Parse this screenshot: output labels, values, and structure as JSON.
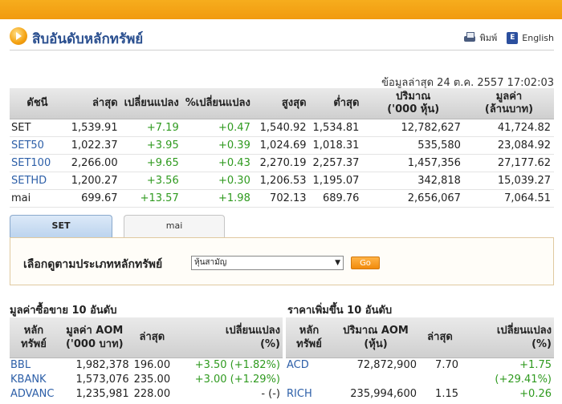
{
  "header": {
    "title": "สิบอันดับหลักทรัพย์",
    "print_label": "พิมพ์",
    "lang_label": "English",
    "lang_icon_text": "E"
  },
  "update_time": "ข้อมูลล่าสุด 24 ต.ค. 2557 17:02:03",
  "index_table": {
    "headers": [
      "ดัชนี",
      "ล่าสุด",
      "เปลี่ยนแปลง",
      "%เปลี่ยนแปลง",
      "สูงสุด",
      "ต่ำสุด",
      "ปริมาณ\n('000 หุ้น)",
      "มูลค่า\n(ล้านบาท)"
    ],
    "rows": [
      {
        "name": "SET",
        "last": "1,539.91",
        "change": "+7.19",
        "pct": "+0.47",
        "high": "1,540.92",
        "low": "1,534.81",
        "volume": "12,782,627",
        "value": "41,724.82"
      },
      {
        "name": "SET50",
        "last": "1,022.37",
        "change": "+3.95",
        "pct": "+0.39",
        "high": "1,024.69",
        "low": "1,018.31",
        "volume": "535,580",
        "value": "23,084.92"
      },
      {
        "name": "SET100",
        "last": "2,266.00",
        "change": "+9.65",
        "pct": "+0.43",
        "high": "2,270.19",
        "low": "2,257.37",
        "volume": "1,457,356",
        "value": "27,177.62"
      },
      {
        "name": "SETHD",
        "last": "1,200.27",
        "change": "+3.56",
        "pct": "+0.30",
        "high": "1,206.53",
        "low": "1,195.07",
        "volume": "342,818",
        "value": "15,039.27"
      },
      {
        "name": "mai",
        "last": "699.67",
        "change": "+13.57",
        "pct": "+1.98",
        "high": "702.13",
        "low": "689.76",
        "volume": "2,656,067",
        "value": "7,064.51"
      }
    ]
  },
  "tabs": {
    "set": "SET",
    "mai": "mai"
  },
  "filter": {
    "label": "เลือกดูตามประเภทหลักทรัพย์",
    "selected": "หุ้นสามัญ",
    "go_label": "Go"
  },
  "left_section": {
    "title": "มูลค่าซื้อขาย 10 อันดับ",
    "headers": [
      "หลัก\nทรัพย์",
      "มูลค่า AOM\n('000 บาท)",
      "ล่าสุด",
      "เปลี่ยนแปลง\n(%)"
    ],
    "rows": [
      {
        "name": "BBL",
        "value": "1,982,378",
        "last": "196.00",
        "change": "+3.50 (+1.82%)"
      },
      {
        "name": "KBANK",
        "value": "1,573,076",
        "last": "235.00",
        "change": "+3.00 (+1.29%)"
      },
      {
        "name": "ADVANC",
        "value": "1,235,981",
        "last": "228.00",
        "change": "- (-)"
      }
    ]
  },
  "right_section": {
    "title": "ราคาเพิ่มขึ้น 10 อันดับ",
    "headers": [
      "หลัก\nทรัพย์",
      "ปริมาณ AOM\n(หุ้น)",
      "ล่าสุด",
      "เปลี่ยนแปลง\n(%)"
    ],
    "rows": [
      {
        "name": "ACD",
        "volume": "72,872,900",
        "last": "7.70",
        "change": "+1.75",
        "pct": "(+29.41%)"
      },
      {
        "name": "RICH",
        "volume": "235,994,600",
        "last": "1.15",
        "change": "+0.26",
        "pct": ""
      }
    ]
  },
  "colors": {
    "accent_orange": "#f19a0f",
    "link_blue": "#2d5fa8",
    "positive_green": "#2f9a1f"
  }
}
